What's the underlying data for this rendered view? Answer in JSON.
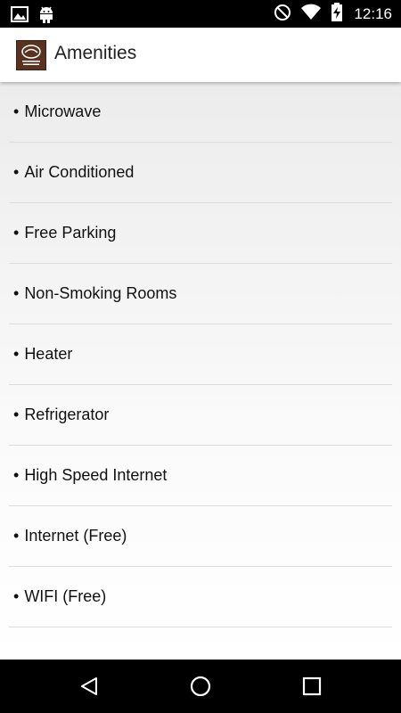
{
  "status_bar": {
    "time": "12:16",
    "left_icons": [
      "image-icon",
      "android-icon"
    ],
    "right_icons": [
      "do-not-disturb-icon",
      "wifi-icon",
      "battery-charging-icon"
    ]
  },
  "app_bar": {
    "title": "Amenities",
    "logo_icon": "hotel-logo-icon"
  },
  "amenities": [
    "Microwave",
    "Air Conditioned",
    "Free Parking",
    "Non-Smoking Rooms",
    "Heater",
    "Refrigerator",
    "High Speed Internet",
    "Internet (Free)",
    "WIFI (Free)"
  ],
  "bullet": "•",
  "nav_bar": {
    "buttons": [
      "back-icon",
      "home-icon",
      "recents-icon"
    ]
  },
  "colors": {
    "status_bar": "#000000",
    "app_bar": "#ffffff",
    "divider": "#dcdcdc",
    "logo": "#5a3320"
  }
}
